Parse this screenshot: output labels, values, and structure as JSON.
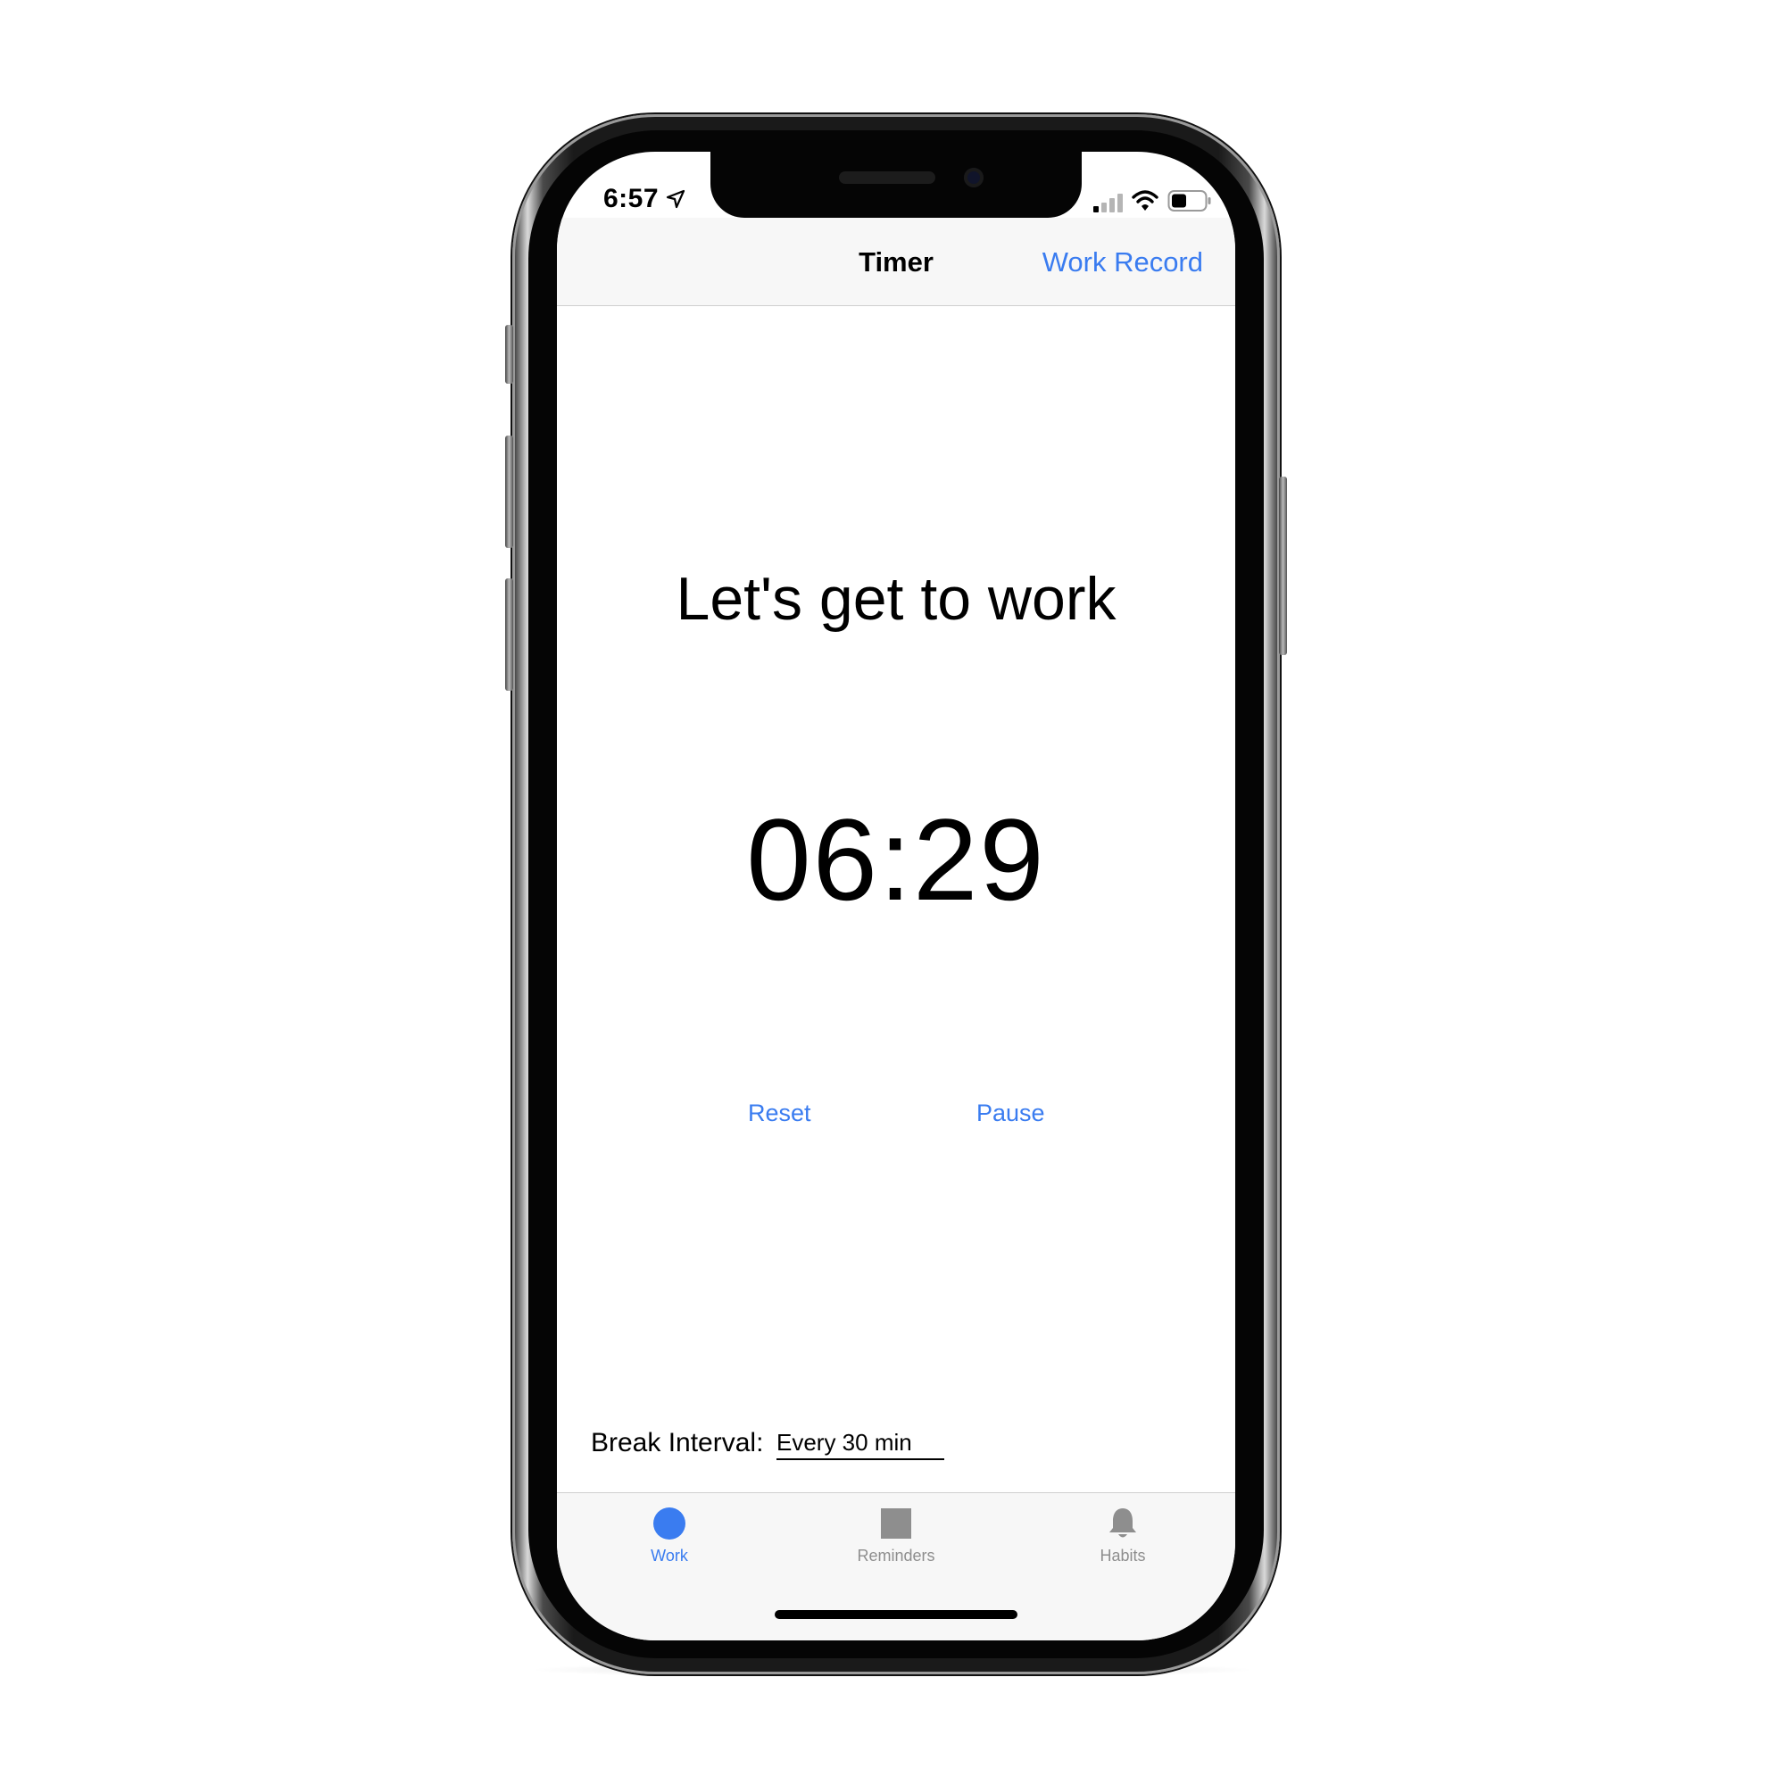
{
  "status_bar": {
    "time": "6:57",
    "location_icon": "location-arrow-icon",
    "signal_icon": "cellular-signal-icon",
    "wifi_icon": "wifi-icon",
    "battery_icon": "battery-icon"
  },
  "nav": {
    "title": "Timer",
    "right_button": "Work Record"
  },
  "main": {
    "headline": "Let's get to work",
    "timer": "06:29",
    "reset_label": "Reset",
    "pause_label": "Pause"
  },
  "break_interval": {
    "label": "Break Interval:",
    "value": "Every 30 min"
  },
  "tabs": [
    {
      "label": "Work",
      "icon": "circle-icon",
      "active": true
    },
    {
      "label": "Reminders",
      "icon": "square-icon",
      "active": false
    },
    {
      "label": "Habits",
      "icon": "bell-icon",
      "active": false
    }
  ],
  "colors": {
    "accent": "#3a7cf0",
    "inactive": "#8e8e8e",
    "bar_background": "#f7f7f7"
  }
}
